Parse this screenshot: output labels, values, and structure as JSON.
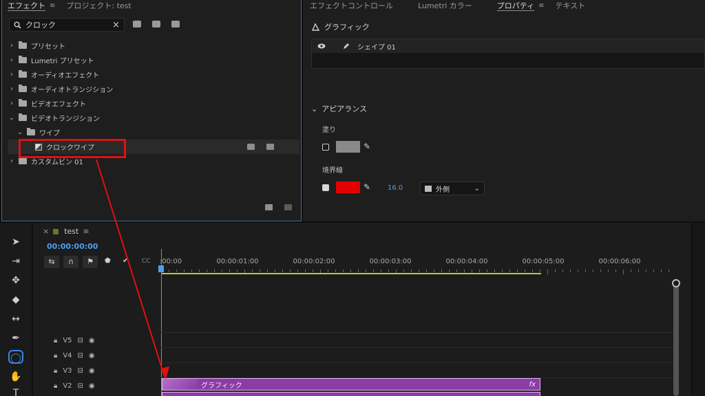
{
  "effects_panel": {
    "tabs": [
      "エフェクト",
      "プロジェクト: test"
    ],
    "menu_glyph": "≡",
    "search_value": "クロック",
    "clear_glyph": "×",
    "tree": [
      {
        "label": "プリセット",
        "expanded": false,
        "level": 0
      },
      {
        "label": "Lumetri プリセット",
        "expanded": false,
        "level": 0
      },
      {
        "label": "オーディオエフェクト",
        "expanded": false,
        "level": 0
      },
      {
        "label": "オーディオトランジション",
        "expanded": false,
        "level": 0
      },
      {
        "label": "ビデオエフェクト",
        "expanded": false,
        "level": 0
      },
      {
        "label": "ビデオトランジション",
        "expanded": true,
        "level": 0
      },
      {
        "label": "ワイプ",
        "expanded": true,
        "level": 1
      },
      {
        "label": "クロックワイプ",
        "level": 2,
        "selected": true
      },
      {
        "label": "カスタムビン 01",
        "expanded": false,
        "level": 0
      }
    ]
  },
  "props_panel": {
    "tabs": [
      "エフェクトコントロール",
      "Lumetri カラー",
      "プロパティ",
      "テキスト"
    ],
    "active_tab": "プロパティ",
    "graphic_label": "グラフィック",
    "shape_label": "シェイプ 01",
    "appearance_label": "アピアランス",
    "fill_label": "塗り",
    "fill_color": "#8a8a8a",
    "stroke_label": "境界線",
    "stroke_color": "#e30000",
    "stroke_width": "16.0",
    "stroke_position": "外側"
  },
  "timeline": {
    "sequence_name": "test",
    "close_glyph": "×",
    "menu_glyph": "≡",
    "timecode": "00:00:00:00",
    "ruler": [
      ":00:00",
      "00:00:01:00",
      "00:00:02:00",
      "00:00:03:00",
      "00:00:04:00",
      "00:00:05:00",
      "00:00:06:00"
    ],
    "tracks": [
      "V5",
      "V4",
      "V3",
      "V2"
    ],
    "clip_label": "グラフィック",
    "clip_fx": "fx",
    "cc_label": "CC"
  },
  "colors": {
    "accent": "#4b9ef0",
    "highlight": "#e01010",
    "clip": "#8c3ca6"
  }
}
